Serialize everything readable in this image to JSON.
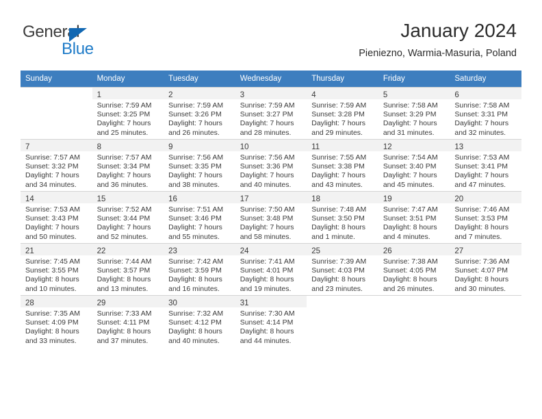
{
  "logo": {
    "word1": "General",
    "word2": "Blue",
    "triangle_color": "#1268b3",
    "word2_color": "#1e7bc8"
  },
  "header": {
    "title": "January 2024",
    "subtitle": "Pieniezno, Warmia-Masuria, Poland"
  },
  "theme": {
    "header_bg": "#3d7ebf",
    "header_text": "#ffffff",
    "daynum_bg": "#f2f2f2",
    "grid_line": "#d4d4d4"
  },
  "weekdays": [
    "Sunday",
    "Monday",
    "Tuesday",
    "Wednesday",
    "Thursday",
    "Friday",
    "Saturday"
  ],
  "weeks": [
    [
      {
        "day": "",
        "sunrise": "",
        "sunset": "",
        "daylight1": "",
        "daylight2": ""
      },
      {
        "day": "1",
        "sunrise": "Sunrise: 7:59 AM",
        "sunset": "Sunset: 3:25 PM",
        "daylight1": "Daylight: 7 hours",
        "daylight2": "and 25 minutes."
      },
      {
        "day": "2",
        "sunrise": "Sunrise: 7:59 AM",
        "sunset": "Sunset: 3:26 PM",
        "daylight1": "Daylight: 7 hours",
        "daylight2": "and 26 minutes."
      },
      {
        "day": "3",
        "sunrise": "Sunrise: 7:59 AM",
        "sunset": "Sunset: 3:27 PM",
        "daylight1": "Daylight: 7 hours",
        "daylight2": "and 28 minutes."
      },
      {
        "day": "4",
        "sunrise": "Sunrise: 7:59 AM",
        "sunset": "Sunset: 3:28 PM",
        "daylight1": "Daylight: 7 hours",
        "daylight2": "and 29 minutes."
      },
      {
        "day": "5",
        "sunrise": "Sunrise: 7:58 AM",
        "sunset": "Sunset: 3:29 PM",
        "daylight1": "Daylight: 7 hours",
        "daylight2": "and 31 minutes."
      },
      {
        "day": "6",
        "sunrise": "Sunrise: 7:58 AM",
        "sunset": "Sunset: 3:31 PM",
        "daylight1": "Daylight: 7 hours",
        "daylight2": "and 32 minutes."
      }
    ],
    [
      {
        "day": "7",
        "sunrise": "Sunrise: 7:57 AM",
        "sunset": "Sunset: 3:32 PM",
        "daylight1": "Daylight: 7 hours",
        "daylight2": "and 34 minutes."
      },
      {
        "day": "8",
        "sunrise": "Sunrise: 7:57 AM",
        "sunset": "Sunset: 3:34 PM",
        "daylight1": "Daylight: 7 hours",
        "daylight2": "and 36 minutes."
      },
      {
        "day": "9",
        "sunrise": "Sunrise: 7:56 AM",
        "sunset": "Sunset: 3:35 PM",
        "daylight1": "Daylight: 7 hours",
        "daylight2": "and 38 minutes."
      },
      {
        "day": "10",
        "sunrise": "Sunrise: 7:56 AM",
        "sunset": "Sunset: 3:36 PM",
        "daylight1": "Daylight: 7 hours",
        "daylight2": "and 40 minutes."
      },
      {
        "day": "11",
        "sunrise": "Sunrise: 7:55 AM",
        "sunset": "Sunset: 3:38 PM",
        "daylight1": "Daylight: 7 hours",
        "daylight2": "and 43 minutes."
      },
      {
        "day": "12",
        "sunrise": "Sunrise: 7:54 AM",
        "sunset": "Sunset: 3:40 PM",
        "daylight1": "Daylight: 7 hours",
        "daylight2": "and 45 minutes."
      },
      {
        "day": "13",
        "sunrise": "Sunrise: 7:53 AM",
        "sunset": "Sunset: 3:41 PM",
        "daylight1": "Daylight: 7 hours",
        "daylight2": "and 47 minutes."
      }
    ],
    [
      {
        "day": "14",
        "sunrise": "Sunrise: 7:53 AM",
        "sunset": "Sunset: 3:43 PM",
        "daylight1": "Daylight: 7 hours",
        "daylight2": "and 50 minutes."
      },
      {
        "day": "15",
        "sunrise": "Sunrise: 7:52 AM",
        "sunset": "Sunset: 3:44 PM",
        "daylight1": "Daylight: 7 hours",
        "daylight2": "and 52 minutes."
      },
      {
        "day": "16",
        "sunrise": "Sunrise: 7:51 AM",
        "sunset": "Sunset: 3:46 PM",
        "daylight1": "Daylight: 7 hours",
        "daylight2": "and 55 minutes."
      },
      {
        "day": "17",
        "sunrise": "Sunrise: 7:50 AM",
        "sunset": "Sunset: 3:48 PM",
        "daylight1": "Daylight: 7 hours",
        "daylight2": "and 58 minutes."
      },
      {
        "day": "18",
        "sunrise": "Sunrise: 7:48 AM",
        "sunset": "Sunset: 3:50 PM",
        "daylight1": "Daylight: 8 hours",
        "daylight2": "and 1 minute."
      },
      {
        "day": "19",
        "sunrise": "Sunrise: 7:47 AM",
        "sunset": "Sunset: 3:51 PM",
        "daylight1": "Daylight: 8 hours",
        "daylight2": "and 4 minutes."
      },
      {
        "day": "20",
        "sunrise": "Sunrise: 7:46 AM",
        "sunset": "Sunset: 3:53 PM",
        "daylight1": "Daylight: 8 hours",
        "daylight2": "and 7 minutes."
      }
    ],
    [
      {
        "day": "21",
        "sunrise": "Sunrise: 7:45 AM",
        "sunset": "Sunset: 3:55 PM",
        "daylight1": "Daylight: 8 hours",
        "daylight2": "and 10 minutes."
      },
      {
        "day": "22",
        "sunrise": "Sunrise: 7:44 AM",
        "sunset": "Sunset: 3:57 PM",
        "daylight1": "Daylight: 8 hours",
        "daylight2": "and 13 minutes."
      },
      {
        "day": "23",
        "sunrise": "Sunrise: 7:42 AM",
        "sunset": "Sunset: 3:59 PM",
        "daylight1": "Daylight: 8 hours",
        "daylight2": "and 16 minutes."
      },
      {
        "day": "24",
        "sunrise": "Sunrise: 7:41 AM",
        "sunset": "Sunset: 4:01 PM",
        "daylight1": "Daylight: 8 hours",
        "daylight2": "and 19 minutes."
      },
      {
        "day": "25",
        "sunrise": "Sunrise: 7:39 AM",
        "sunset": "Sunset: 4:03 PM",
        "daylight1": "Daylight: 8 hours",
        "daylight2": "and 23 minutes."
      },
      {
        "day": "26",
        "sunrise": "Sunrise: 7:38 AM",
        "sunset": "Sunset: 4:05 PM",
        "daylight1": "Daylight: 8 hours",
        "daylight2": "and 26 minutes."
      },
      {
        "day": "27",
        "sunrise": "Sunrise: 7:36 AM",
        "sunset": "Sunset: 4:07 PM",
        "daylight1": "Daylight: 8 hours",
        "daylight2": "and 30 minutes."
      }
    ],
    [
      {
        "day": "28",
        "sunrise": "Sunrise: 7:35 AM",
        "sunset": "Sunset: 4:09 PM",
        "daylight1": "Daylight: 8 hours",
        "daylight2": "and 33 minutes."
      },
      {
        "day": "29",
        "sunrise": "Sunrise: 7:33 AM",
        "sunset": "Sunset: 4:11 PM",
        "daylight1": "Daylight: 8 hours",
        "daylight2": "and 37 minutes."
      },
      {
        "day": "30",
        "sunrise": "Sunrise: 7:32 AM",
        "sunset": "Sunset: 4:12 PM",
        "daylight1": "Daylight: 8 hours",
        "daylight2": "and 40 minutes."
      },
      {
        "day": "31",
        "sunrise": "Sunrise: 7:30 AM",
        "sunset": "Sunset: 4:14 PM",
        "daylight1": "Daylight: 8 hours",
        "daylight2": "and 44 minutes."
      },
      {
        "day": "",
        "sunrise": "",
        "sunset": "",
        "daylight1": "",
        "daylight2": ""
      },
      {
        "day": "",
        "sunrise": "",
        "sunset": "",
        "daylight1": "",
        "daylight2": ""
      },
      {
        "day": "",
        "sunrise": "",
        "sunset": "",
        "daylight1": "",
        "daylight2": ""
      }
    ]
  ]
}
